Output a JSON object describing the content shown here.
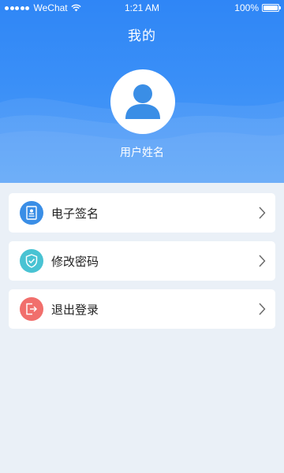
{
  "status_bar": {
    "carrier": "WeChat",
    "time": "1:21 AM",
    "battery": "100%",
    "battery_level": 1.0
  },
  "header": {
    "title": "我的",
    "username": "用户姓名"
  },
  "menu": [
    {
      "label": "电子签名",
      "icon": "signature-doc-icon",
      "color": "#3a8ee6"
    },
    {
      "label": "修改密码",
      "icon": "shield-icon",
      "color": "#49c3d3"
    },
    {
      "label": "退出登录",
      "icon": "logout-icon",
      "color": "#f16f6c"
    }
  ],
  "colors": {
    "header_top": "#2f86f6",
    "header_bottom": "#4f9df8",
    "background": "#eaf0f7",
    "avatar_fill": "#3a8ee6"
  }
}
